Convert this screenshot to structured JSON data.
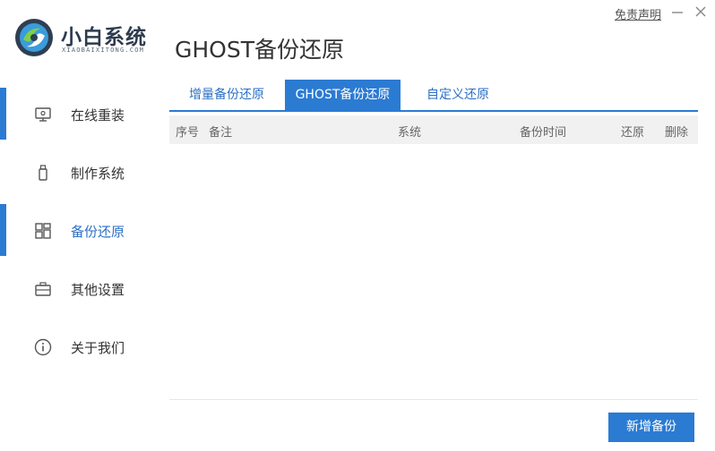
{
  "brand": {
    "name": "小白系统",
    "subtitle": "XIAOBAIXITONG.COM"
  },
  "titlebar": {
    "disclaimer": "免责声明",
    "minimize_icon": "minimize-icon",
    "close_icon": "close-icon"
  },
  "page": {
    "title": "GHOST备份还原"
  },
  "sidebar": {
    "items": [
      {
        "label": "在线重装",
        "icon": "monitor-icon",
        "active": false
      },
      {
        "label": "制作系统",
        "icon": "usb-drive-icon",
        "active": false
      },
      {
        "label": "备份还原",
        "icon": "grid-icon",
        "active": true
      },
      {
        "label": "其他设置",
        "icon": "toolbox-icon",
        "active": false
      },
      {
        "label": "关于我们",
        "icon": "info-icon",
        "active": false
      }
    ]
  },
  "tabs": [
    {
      "label": "增量备份还原",
      "active": false
    },
    {
      "label": "GHOST备份还原",
      "active": true
    },
    {
      "label": "自定义还原",
      "active": false
    }
  ],
  "table": {
    "columns": [
      "序号",
      "备注",
      "系统",
      "备份时间",
      "还原",
      "删除"
    ],
    "rows": []
  },
  "actions": {
    "add_backup": "新增备份"
  },
  "colors": {
    "accent": "#2b7bd3",
    "brand_text": "#2d3b4f",
    "active_text": "#2b6fc4"
  }
}
